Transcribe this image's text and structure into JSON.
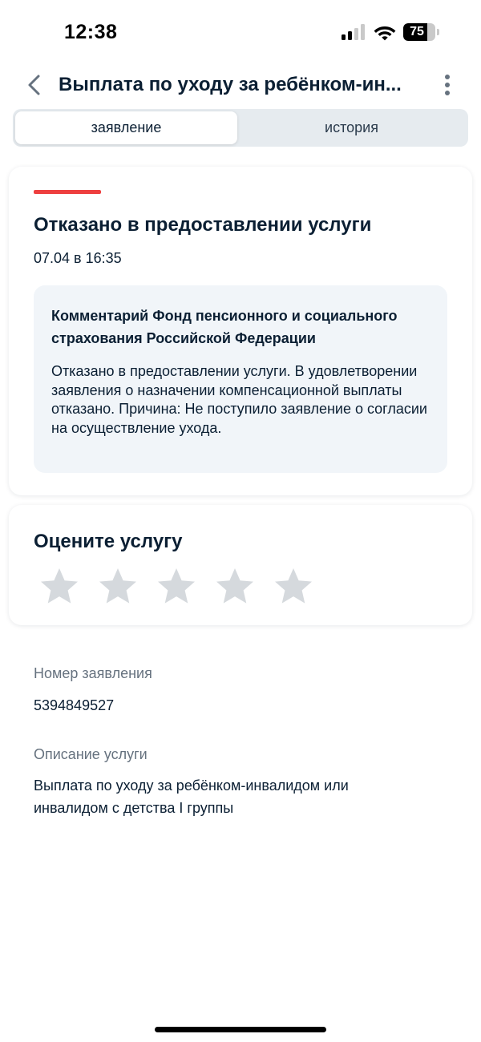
{
  "status_bar": {
    "time": "12:38",
    "battery_level": "75",
    "battery_fraction": 0.75
  },
  "header": {
    "title": "Выплата по уходу за ребёнком-ин..."
  },
  "tabs": [
    {
      "label": "заявление",
      "active": true
    },
    {
      "label": "история",
      "active": false
    }
  ],
  "status_card": {
    "accent_color": "#ee3f3f",
    "title": "Отказано в предоставлении услуги",
    "date": "07.04 в 16:35",
    "comment": {
      "title": "Комментарий Фонд пенсионного и социального страхования Российской Федерации",
      "text": "Отказано в предоставлении услуги. В удовлетворении заявления о назначении компенсационной выплаты отказано. Причина: Не поступило заявление о согласии на осуществление ухода."
    }
  },
  "rating": {
    "title": "Оцените услугу",
    "max_stars": 5,
    "selected": 0,
    "star_color": "#d5d9dd"
  },
  "application": {
    "number_label": "Номер заявления",
    "number_value": "5394849527",
    "description_label": "Описание услуги",
    "description_value": "Выплата по уходу за ребёнком-инвалидом или инвалидом с детства I группы"
  },
  "icons": {
    "back": "chevron-left-icon",
    "more": "more-vertical-icon",
    "star": "star-icon",
    "signal": "cellular-signal-icon",
    "wifi": "wifi-icon",
    "battery": "battery-icon"
  }
}
